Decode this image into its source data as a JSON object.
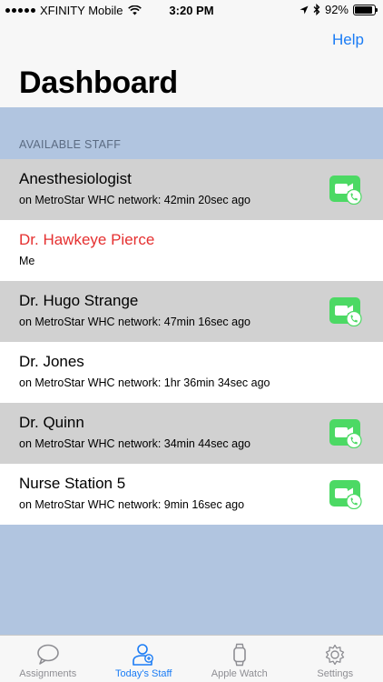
{
  "status_bar": {
    "carrier": "XFINITY Mobile",
    "time": "3:20 PM",
    "battery": "92%",
    "battery_level": 0.92
  },
  "nav": {
    "help_label": "Help",
    "title": "Dashboard"
  },
  "section": {
    "header": "AVAILABLE STAFF"
  },
  "staff": [
    {
      "name": "Anesthesiologist",
      "detail": "on MetroStar WHC network: 42min 20sec ago",
      "call": true,
      "self": false
    },
    {
      "name": "Dr. Hawkeye Pierce",
      "detail": "Me",
      "call": false,
      "self": true
    },
    {
      "name": "Dr. Hugo Strange",
      "detail": "on MetroStar WHC network: 47min 16sec ago",
      "call": true,
      "self": false
    },
    {
      "name": "Dr. Jones",
      "detail": "on MetroStar WHC network: 1hr 36min 34sec ago",
      "call": false,
      "self": false
    },
    {
      "name": "Dr. Quinn",
      "detail": "on MetroStar WHC network: 34min 44sec ago",
      "call": true,
      "self": false
    },
    {
      "name": "Nurse Station 5",
      "detail": "on MetroStar WHC network: 9min 16sec ago",
      "call": true,
      "self": false
    }
  ],
  "tabs": [
    {
      "label": "Assignments",
      "icon": "speech-bubble-icon",
      "active": false
    },
    {
      "label": "Today's Staff",
      "icon": "staff-icon",
      "active": true
    },
    {
      "label": "Apple Watch",
      "icon": "watch-icon",
      "active": false
    },
    {
      "label": "Settings",
      "icon": "gear-icon",
      "active": false
    }
  ],
  "colors": {
    "accent": "#1a7cf5",
    "self_name": "#e53030",
    "call_green": "#4cd964",
    "background": "#b1c5e0",
    "alt_row": "#d1d1d1"
  }
}
